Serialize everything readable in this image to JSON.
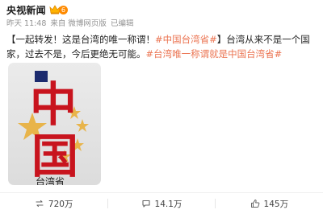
{
  "author": {
    "name": "央视新闻",
    "vip_level": "6",
    "crown_icon": "vip-crown-icon"
  },
  "meta": {
    "time": "昨天 11:48",
    "source": "来自 微博网页版",
    "edited": "已编辑"
  },
  "post": {
    "prefix": "【一起转发！这是台湾的唯一称谓！",
    "topic1": "#中国台湾省#",
    "middle": "】台湾从来不是一个国家，过去不是，今后更绝无可能。",
    "topic2": "#台湾唯一称谓就是中国台湾省#"
  },
  "image": {
    "char1": "中",
    "char2": "国",
    "bottom_text": "台湾省"
  },
  "actions": {
    "repost": "720万",
    "comment": "14.1万",
    "like": "145万"
  },
  "colors": {
    "topic": "#eb7350",
    "image_red": "#c8141e",
    "star_gold": "#e8b44a",
    "vip_orange": "#ff8a00"
  }
}
